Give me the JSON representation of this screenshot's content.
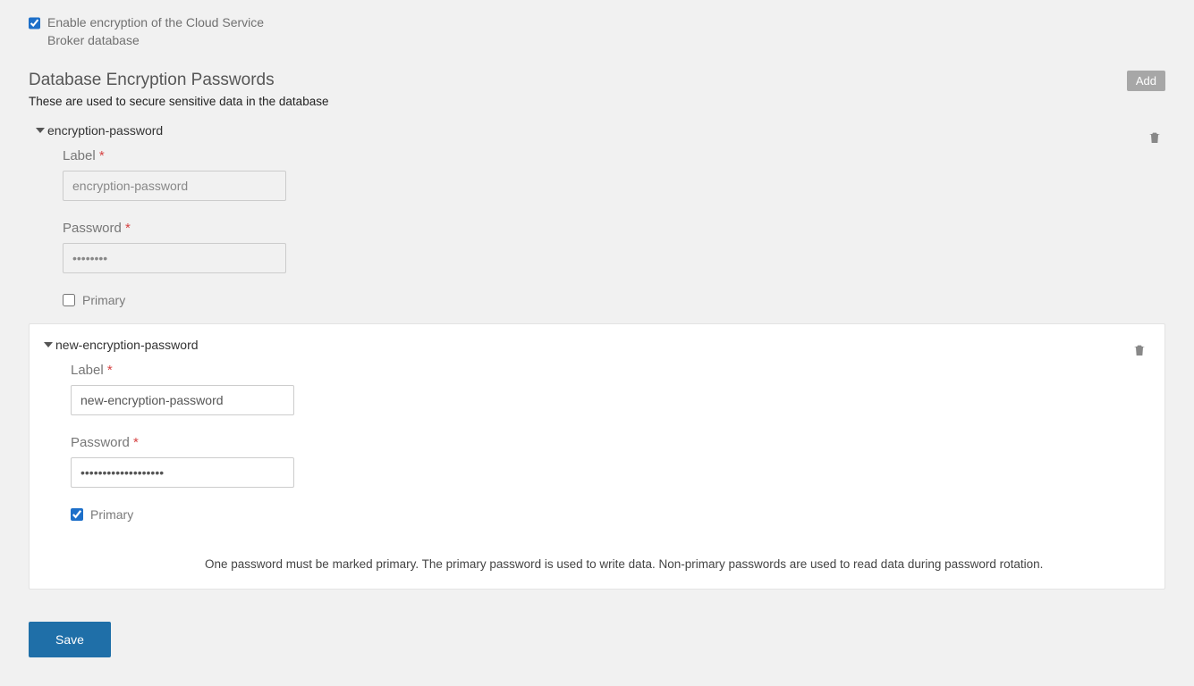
{
  "enable_encryption": {
    "checked": true,
    "label": "Enable encryption of the Cloud Service Broker database"
  },
  "section": {
    "title": "Database Encryption Passwords",
    "subtitle": "These are used to secure sensitive data in the database",
    "add_label": "Add"
  },
  "field_labels": {
    "label": "Label",
    "password": "Password",
    "primary": "Primary",
    "required": "*"
  },
  "entries": [
    {
      "title": "encryption-password",
      "label_value": "encryption-password",
      "password_value": "••••••••",
      "primary": false,
      "active": false
    },
    {
      "title": "new-encryption-password",
      "label_value": "new-encryption-password",
      "password_value": "•••••••••••••••••••",
      "primary": true,
      "active": true
    }
  ],
  "primary_help": "One password must be marked primary. The primary password is used to write data. Non-primary passwords are used to read data during password rotation.",
  "save_label": "Save"
}
